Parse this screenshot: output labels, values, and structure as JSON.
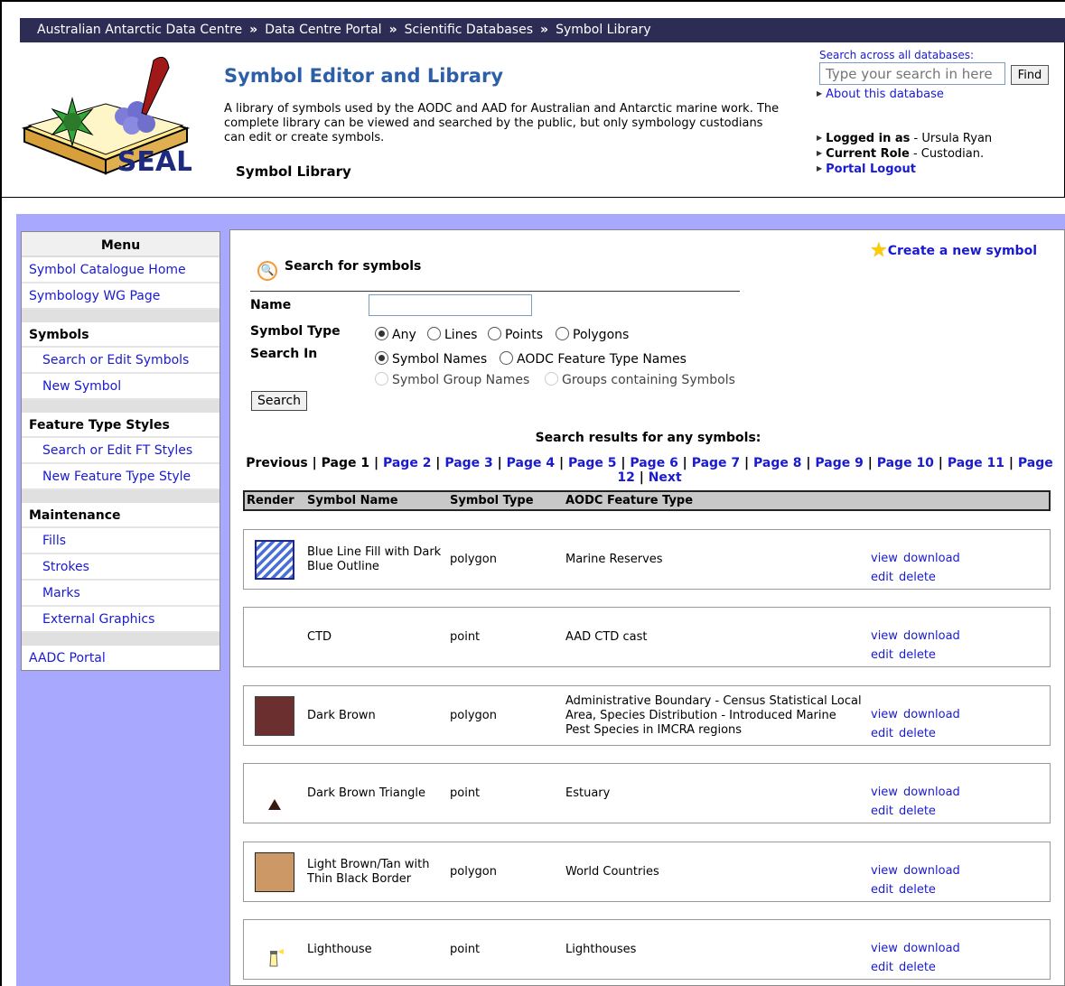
{
  "breadcrumb": [
    "Australian Antarctic Data Centre",
    "Data Centre Portal",
    "Scientific Databases",
    "Symbol Library"
  ],
  "breadcrumb_separator": "»",
  "header": {
    "logo_text": "SEAL",
    "title": "Symbol Editor and Library",
    "description": "A library of symbols used by the AODC and AAD for Australian and Antarctic marine work. The complete library can be viewed and searched by the public, but only symbology custodians can edit or create symbols.",
    "subtitle": "Symbol Library",
    "search_label": "Search across all databases:",
    "search_placeholder": "Type your search in here",
    "find_label": "Find",
    "about_link": "About this database",
    "logged_in_label": "Logged in as",
    "logged_in_value": " - Ursula Ryan",
    "role_label": "Current Role",
    "role_value": " - Custodian.",
    "logout_link": "Portal Logout"
  },
  "menu": {
    "title": "Menu",
    "catalogue_home": "Symbol Catalogue Home",
    "wg_page": "Symbology WG Page",
    "symbols_heading": "Symbols",
    "search_edit_symbols": "Search or Edit Symbols",
    "new_symbol": "New Symbol",
    "ft_heading": "Feature Type Styles",
    "search_edit_ft": "Search or Edit FT Styles",
    "new_ft": "New Feature Type Style",
    "maint_heading": "Maintenance",
    "fills": "Fills",
    "strokes": "Strokes",
    "marks": "Marks",
    "external_graphics": "External Graphics",
    "aadc_portal": "AADC Portal"
  },
  "main": {
    "create_link": "Create a new symbol",
    "search_title": "Search for symbols",
    "name_label": "Name",
    "name_value": "",
    "type_label": "Symbol Type",
    "type_options": [
      "Any",
      "Lines",
      "Points",
      "Polygons"
    ],
    "type_selected": "Any",
    "search_in_label": "Search In",
    "search_in_options": [
      "Symbol Names",
      "AODC Feature Type Names",
      "Symbol Group Names",
      "Groups containing Symbols"
    ],
    "search_in_selected": "Symbol Names",
    "search_button": "Search",
    "results_title": "Search results for any symbols:",
    "pager": {
      "previous": "Previous",
      "current": "Page 1",
      "pages": [
        "Page 2",
        "Page 3",
        "Page 4",
        "Page 5",
        "Page 6",
        "Page 7",
        "Page 8",
        "Page 9",
        "Page 10",
        "Page 11",
        "Page 12"
      ],
      "next": "Next"
    },
    "columns": [
      "Render",
      "Symbol Name",
      "Symbol Type",
      "AODC Feature Type"
    ],
    "actions": {
      "view": "view",
      "download": "download",
      "edit": "edit",
      "delete": "delete"
    },
    "rows": [
      {
        "name": "Blue Line Fill with Dark Blue Outline",
        "type": "polygon",
        "feature": "Marine Reserves",
        "render": "hatch-fill"
      },
      {
        "name": "CTD",
        "type": "point",
        "feature": "AAD CTD cast",
        "render": "none"
      },
      {
        "name": "Dark Brown",
        "type": "polygon",
        "feature": "Administrative Boundary - Census Statistical Local Area, Species Distribution - Introduced Marine Pest Species in IMCRA regions",
        "render": "solid-fill",
        "color": "#6b2f2f"
      },
      {
        "name": "Dark Brown Triangle",
        "type": "point",
        "feature": "Estuary",
        "render": "triangle",
        "color": "#3a1a10"
      },
      {
        "name": "Light Brown/Tan with Thin Black Border",
        "type": "polygon",
        "feature": "World Countries",
        "render": "solid-fill",
        "color": "#cc9966"
      },
      {
        "name": "Lighthouse",
        "type": "point",
        "feature": "Lighthouses",
        "render": "lighthouse-icon"
      }
    ]
  },
  "colors": {
    "breadcrumb_bg": "#2c2c55",
    "title": "#2c5fa8",
    "link": "#1a1ad0",
    "page_bg": "#a8a8ff"
  }
}
